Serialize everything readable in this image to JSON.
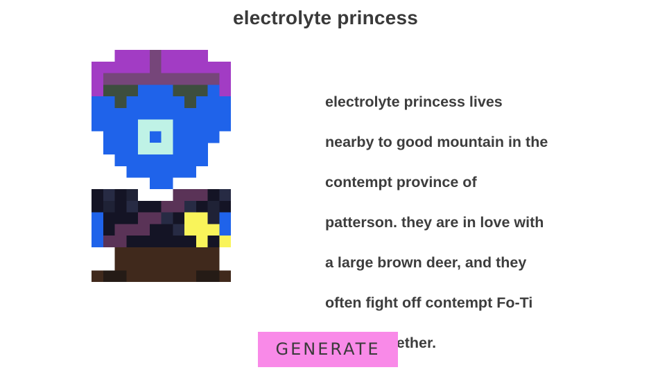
{
  "character": {
    "name": "electrolyte princess",
    "bio_lines": [
      "electrolyte princess lives",
      "nearby to good mountain in the",
      "contempt  province of",
      "patterson. they are in love with",
      "a large brown deer, and they",
      "often fight off contempt  Fo-Ti",
      "fairies together."
    ]
  },
  "controls": {
    "generate_label": "GENERATE"
  },
  "colors": {
    "hair": "#a23cc4",
    "hair_shade": "#76467a",
    "skin": "#1f63ea",
    "brows": "#3d4e3e",
    "eye_rim": "#bff2e6",
    "collar": "#ffffff",
    "shirt": "#141425",
    "sash": "#5a3357",
    "star": "#f9f45a",
    "pants": "#40291c",
    "boots": "#251b16",
    "button_bg": "#f98ae8"
  }
}
